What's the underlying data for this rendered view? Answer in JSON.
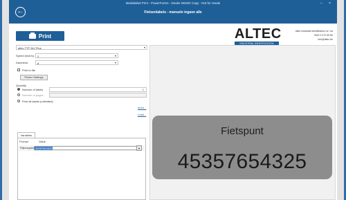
{
  "window": {
    "title": "Medialabel Print - PowerForms - Dealer DEMO Copy - Not for resale",
    "subtitle": "Fietsenlabels - manuele ingave alle",
    "controls": "–  ×"
  },
  "toolbar": {
    "print_label": "Print"
  },
  "brand": {
    "logo_text": "ALTEC",
    "logo_tagline": "INDUSTRIAL IDENTIFICATION",
    "company_line1": "altec industrial identification nv / sa",
    "company_line2": "0032 3 270 99 80",
    "company_line3": "info@altec.be"
  },
  "settings": {
    "printer": "altec TTP 342 Plus",
    "speed_label": "Speed (inch/s):",
    "speed_value": "2",
    "darkness_label": "Darkness:",
    "darkness_value": "8",
    "print_to_file_label": "Print to file",
    "printer_settings_label": "Printer Settings",
    "quantity_label": "Quantity",
    "num_labels_label": "Number of labels",
    "num_labels_value": "1",
    "num_pages_label": "Number of pages",
    "print_all_label": "Print all labels (unlimited)",
    "more_link": "more...",
    "load_link": "Load..."
  },
  "variables": {
    "tab_label": "Variables",
    "col_prompt": "Prompt",
    "col_value": "Value",
    "row_prompt": "Rijksregister",
    "row_value": "45357654325",
    "browse_btn": "▾"
  },
  "preview": {
    "label_title": "Fietspunt",
    "label_number": "45357654325"
  },
  "colors": {
    "accent": "#1e5f98",
    "label_bg": "#8d8d8d"
  }
}
